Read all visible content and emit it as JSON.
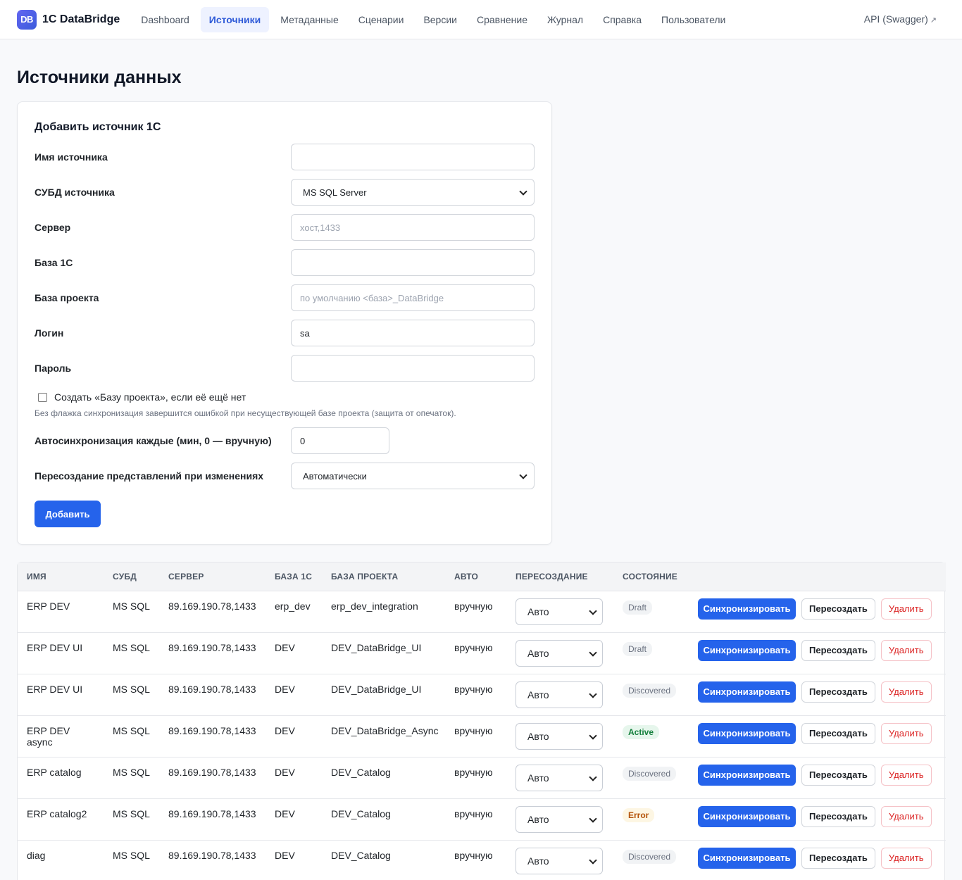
{
  "brand": {
    "logo_text": "DB",
    "name": "1C DataBridge"
  },
  "nav": {
    "items": [
      {
        "label": "Dashboard"
      },
      {
        "label": "Источники"
      },
      {
        "label": "Метаданные"
      },
      {
        "label": "Сценарии"
      },
      {
        "label": "Версии"
      },
      {
        "label": "Сравнение"
      },
      {
        "label": "Журнал"
      },
      {
        "label": "Справка"
      },
      {
        "label": "Пользователи"
      }
    ],
    "active_index": 1,
    "api_link": "API (Swagger)",
    "api_link_icon": "↗"
  },
  "page_title": "Источники данных",
  "form": {
    "title": "Добавить источник 1С",
    "source_name": {
      "label": "Имя источника",
      "value": ""
    },
    "dbms": {
      "label": "СУБД источника",
      "value": "MS SQL Server"
    },
    "server": {
      "label": "Сервер",
      "placeholder": "хост,1433"
    },
    "db_1c": {
      "label": "База 1С",
      "value": ""
    },
    "project_db": {
      "label": "База проекта",
      "placeholder": "по умолчанию <база>_DataBridge"
    },
    "login": {
      "label": "Логин",
      "value": "sa"
    },
    "password": {
      "label": "Пароль",
      "value": ""
    },
    "create_checkbox": {
      "label": "Создать «Базу проекта», если её ещё нет",
      "checked": false
    },
    "hint": "Без флажка синхронизация завершится ошибкой при несуществующей базе проекта (защита от опечаток).",
    "autosync": {
      "label": "Автосинхронизация каждые (мин, 0 — вручную)",
      "value": "0"
    },
    "recreate": {
      "label": "Пересоздание представлений при изменениях",
      "value": "Автоматически"
    },
    "submit": "Добавить"
  },
  "table": {
    "headers": [
      "Имя",
      "СУБД",
      "Сервер",
      "База 1С",
      "База проекта",
      "Авто",
      "Пересоздание",
      "Состояние",
      ""
    ],
    "action_labels": {
      "sync": "Синхронизировать",
      "recreate": "Пересоздать",
      "delete": "Удалить"
    },
    "rows": [
      {
        "name": "ERP DEV",
        "dbms": "MS SQL",
        "server": "89.169.190.78,1433",
        "db1c": "erp_dev",
        "project": "erp_dev_integration",
        "auto": "вручную",
        "recreate": "Авто",
        "state": "Draft",
        "state_kind": "neutral"
      },
      {
        "name": "ERP DEV UI",
        "dbms": "MS SQL",
        "server": "89.169.190.78,1433",
        "db1c": "DEV",
        "project": "DEV_DataBridge_UI",
        "auto": "вручную",
        "recreate": "Авто",
        "state": "Draft",
        "state_kind": "neutral"
      },
      {
        "name": "ERP DEV UI",
        "dbms": "MS SQL",
        "server": "89.169.190.78,1433",
        "db1c": "DEV",
        "project": "DEV_DataBridge_UI",
        "auto": "вручную",
        "recreate": "Авто",
        "state": "Discovered",
        "state_kind": "neutral"
      },
      {
        "name": "ERP DEV async",
        "dbms": "MS SQL",
        "server": "89.169.190.78,1433",
        "db1c": "DEV",
        "project": "DEV_DataBridge_Async",
        "auto": "вручную",
        "recreate": "Авто",
        "state": "Active",
        "state_kind": "active"
      },
      {
        "name": "ERP catalog",
        "dbms": "MS SQL",
        "server": "89.169.190.78,1433",
        "db1c": "DEV",
        "project": "DEV_Catalog",
        "auto": "вручную",
        "recreate": "Авто",
        "state": "Discovered",
        "state_kind": "neutral"
      },
      {
        "name": "ERP catalog2",
        "dbms": "MS SQL",
        "server": "89.169.190.78,1433",
        "db1c": "DEV",
        "project": "DEV_Catalog",
        "auto": "вручную",
        "recreate": "Авто",
        "state": "Error",
        "state_kind": "error"
      },
      {
        "name": "diag",
        "dbms": "MS SQL",
        "server": "89.169.190.78,1433",
        "db1c": "DEV",
        "project": "DEV_Catalog",
        "auto": "вручную",
        "recreate": "Авто",
        "state": "Discovered",
        "state_kind": "neutral"
      }
    ]
  },
  "colors": {
    "accent": "#2563eb",
    "danger": "#dc2626",
    "active": "#15803d",
    "error": "#b45309"
  }
}
